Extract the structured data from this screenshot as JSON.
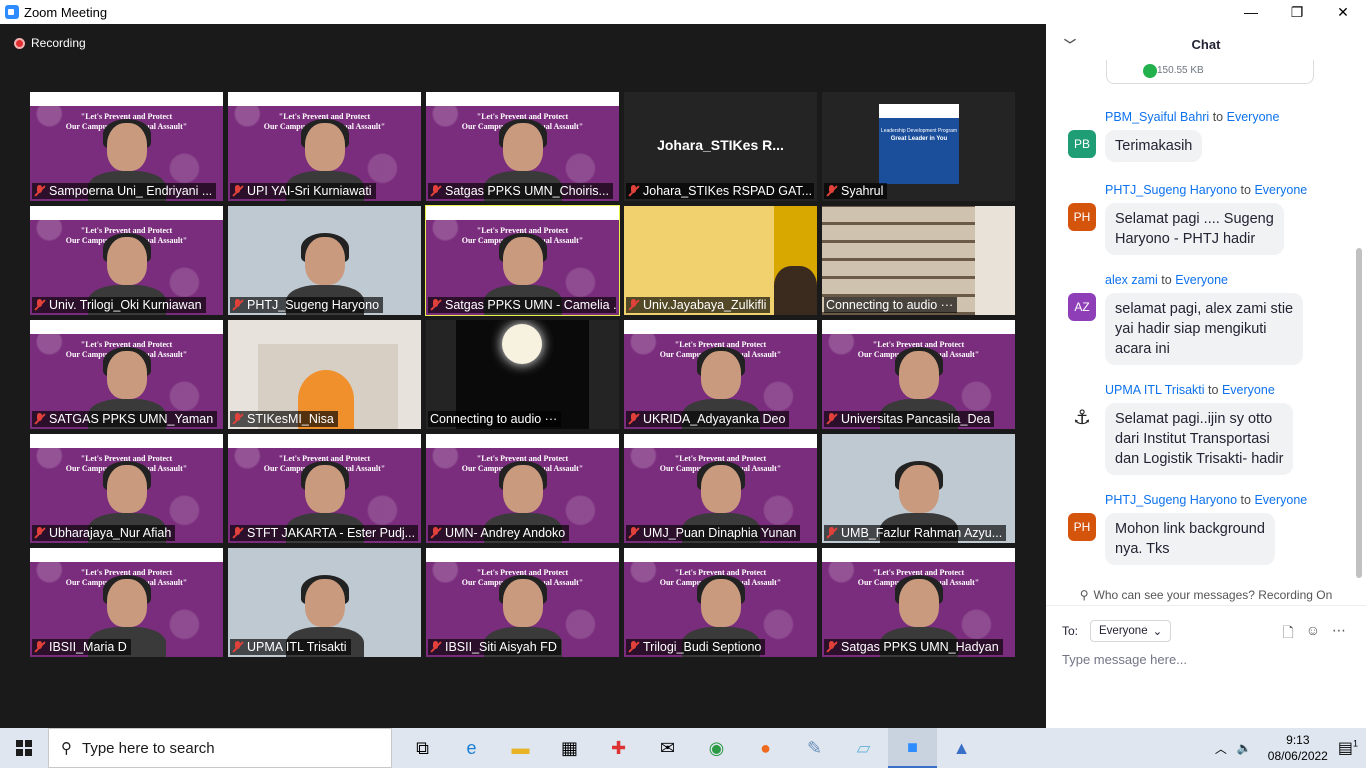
{
  "window": {
    "title": "Zoom Meeting",
    "minimize": "—",
    "maximize": "❐",
    "close": "✕"
  },
  "meeting": {
    "recording_label": "Recording",
    "tiles": [
      {
        "name": "Sampoerna Uni_ Endriyani ...",
        "kind": "banner",
        "muted": true
      },
      {
        "name": "UPI YAI-Sri Kurniawati",
        "kind": "banner",
        "muted": true
      },
      {
        "name": "Satgas PPKS UMN_Choiris...",
        "kind": "banner",
        "muted": true
      },
      {
        "name": "Johara_STIKes RSPAD GAT...",
        "kind": "name",
        "bigname": "Johara_STIKes  R...",
        "muted": true
      },
      {
        "name": "Syahrul",
        "kind": "slide",
        "slide_title": "Leadership Development Program",
        "slide_sub": "Great Leader in You",
        "muted": true
      },
      {
        "name": "Univ. Trilogi_Oki Kurniawan",
        "kind": "banner",
        "muted": true
      },
      {
        "name": "PHTJ_Sugeng Haryono",
        "kind": "room",
        "muted": true
      },
      {
        "name": "Satgas PPKS UMN - Camelia ...",
        "kind": "banner",
        "muted": true,
        "active": true
      },
      {
        "name": "Univ.Jayabaya_Zulkifli",
        "kind": "yellow",
        "muted": true
      },
      {
        "name": "Connecting to audio ···",
        "kind": "shelf",
        "muted": false
      },
      {
        "name": "SATGAS PPKS UMN_Yaman",
        "kind": "banner",
        "muted": true
      },
      {
        "name": "STIKesMI_Nisa",
        "kind": "building",
        "muted": true
      },
      {
        "name": "Connecting to audio ···",
        "kind": "dark",
        "muted": false
      },
      {
        "name": "UKRIDA_Adyayanka Deo",
        "kind": "banner",
        "muted": true
      },
      {
        "name": "Universitas Pancasila_Dea",
        "kind": "banner",
        "muted": true
      },
      {
        "name": "Ubharajaya_Nur Afiah",
        "kind": "banner",
        "muted": true
      },
      {
        "name": "STFT JAKARTA - Ester Pudj...",
        "kind": "banner",
        "muted": true
      },
      {
        "name": "UMN- Andrey Andoko",
        "kind": "banner",
        "muted": true
      },
      {
        "name": "UMJ_Puan Dinaphia Yunan",
        "kind": "banner",
        "muted": true
      },
      {
        "name": "UMB_Fazlur Rahman Azyu...",
        "kind": "room",
        "muted": true
      },
      {
        "name": "IBSII_Maria D",
        "kind": "banner",
        "muted": true
      },
      {
        "name": "UPMA ITL Trisakti",
        "kind": "room",
        "muted": true
      },
      {
        "name": "IBSII_Siti Aisyah FD",
        "kind": "banner",
        "muted": true
      },
      {
        "name": "Trilogi_Budi Septiono",
        "kind": "banner",
        "muted": true
      },
      {
        "name": "Satgas PPKS UMN_Hadyan",
        "kind": "banner",
        "muted": true
      }
    ],
    "banner_text": [
      "\"Let's Prevent and Protect",
      "Our Campus From Sexual Assault\""
    ]
  },
  "chat": {
    "title": "Chat",
    "file_size": "150.55 KB",
    "to_word": "to",
    "messages": [
      {
        "from": "PBM_Syaiful Bahri",
        "to": "Everyone",
        "initials": "PB",
        "color": "#1f9d74",
        "text": [
          "Terimakasih"
        ]
      },
      {
        "from": "PHTJ_Sugeng Haryono",
        "to": "Everyone",
        "initials": "PH",
        "color": "#d4540c",
        "text": [
          "Selamat pagi .... Sugeng",
          "Haryono - PHTJ hadir"
        ]
      },
      {
        "from": "alex zami",
        "to": "Everyone",
        "initials": "AZ",
        "color": "#8e3fb8",
        "text": [
          "selamat pagi, alex zami stie",
          "yai hadir siap mengikuti",
          "acara ini"
        ]
      },
      {
        "from": "UPMA ITL Trisakti",
        "to": "Everyone",
        "initials": "",
        "color": "#ffffff",
        "text": [
          "Selamat pagi..ijin sy otto",
          "dari Institut Transportasi",
          "dan Logistik Trisakti- hadir"
        ]
      },
      {
        "from": "PHTJ_Sugeng Haryono",
        "to": "Everyone",
        "initials": "PH",
        "color": "#d4540c",
        "text": [
          "Mohon link background",
          "nya. Tks"
        ]
      }
    ],
    "who_can_see": "Who can see your messages? Recording On",
    "to_label": "To:",
    "recipient": "Everyone",
    "input_placeholder": "Type message here..."
  },
  "taskbar": {
    "search_placeholder": "Type here to search",
    "time": "9:13",
    "date": "08/06/2022",
    "notifications": "1"
  }
}
